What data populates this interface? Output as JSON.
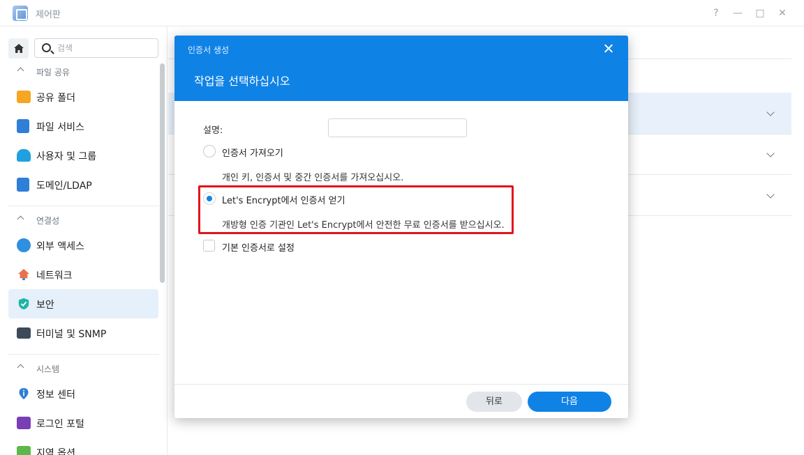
{
  "window": {
    "title": "제어판",
    "controls": [
      "?",
      "—",
      "□",
      "✕"
    ]
  },
  "sidebar": {
    "search_placeholder": "검색",
    "sections": [
      {
        "header": "파일 공유",
        "items": [
          "공유 폴더",
          "파일 서비스",
          "사용자 및 그룹",
          "도메인/LDAP"
        ]
      },
      {
        "header": "연결성",
        "items": [
          "외부 액세스",
          "네트워크",
          "보안",
          "터미널 및 SNMP"
        ]
      },
      {
        "header": "시스템",
        "items": [
          "정보 센터",
          "로그인 포털",
          "지역 옵션"
        ]
      }
    ],
    "active_item": "보안"
  },
  "modal": {
    "small_title": "인증서 생성",
    "big_title": "작업을 선택하십시오",
    "description_label": "설명:",
    "description_value": "",
    "options": [
      {
        "label": "인증서 가져오기",
        "help": "개인 키, 인증서 및 중간 인증서를 가져오십시오.",
        "selected": false
      },
      {
        "label": "Let's Encrypt에서 인증서 얻기",
        "help": "개방형 인증 기관인 Let's Encrypt에서 안전한 무료 인증서를 받으십시오.",
        "selected": true
      }
    ],
    "checkbox_label": "기본 인증서로 설정",
    "checkbox_checked": false,
    "back_label": "뒤로",
    "next_label": "다음"
  },
  "colors": {
    "accent": "#0f82e6",
    "highlight": "#e0141e",
    "active_bg": "#e6f0fb"
  },
  "icons": [
    "home-icon",
    "search-icon",
    "close-icon",
    "folder-icon",
    "file-services-icon",
    "users-icon",
    "domain-icon",
    "external-access-icon",
    "network-icon",
    "shield-icon",
    "terminal-icon",
    "info-icon",
    "login-portal-icon"
  ]
}
